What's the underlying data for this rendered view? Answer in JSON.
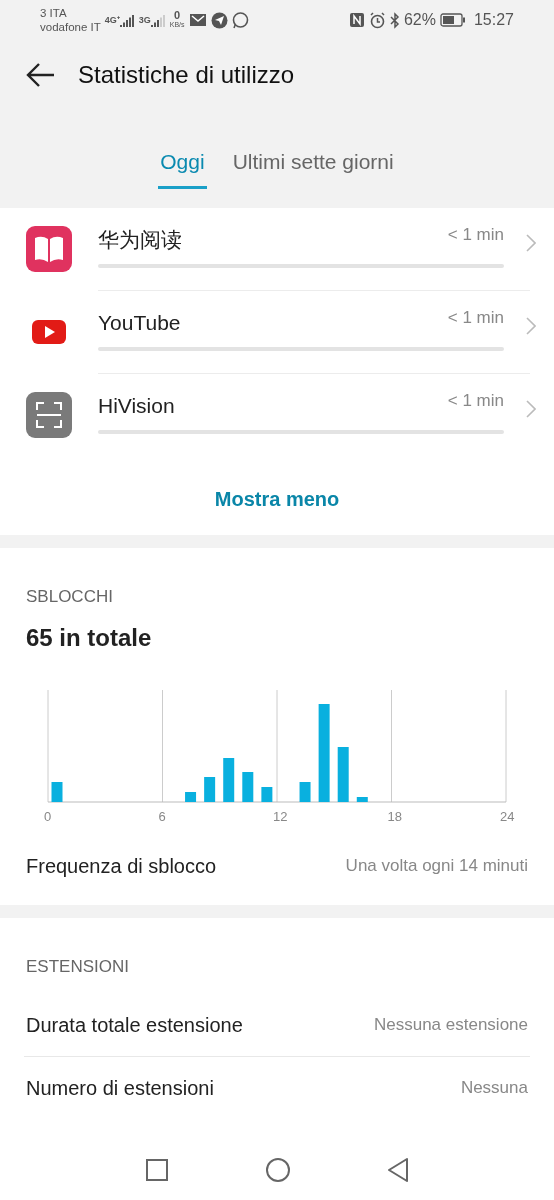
{
  "status_bar": {
    "carrier_1": "3 ITA",
    "carrier_2": "vodafone IT",
    "net_1": "4G⁺",
    "net_2": "3G",
    "speed_value": "0",
    "speed_unit": "KB/s",
    "battery_text": "62%",
    "time": "15:27"
  },
  "header": {
    "title": "Statistiche di utilizzo"
  },
  "tabs": [
    {
      "label": "Oggi",
      "selected": true
    },
    {
      "label": "Ultimi sette giorni",
      "selected": false
    }
  ],
  "apps": [
    {
      "name": "华为阅读",
      "time": "< 1 min",
      "kind": "book"
    },
    {
      "name": "YouTube",
      "time": "< 1 min",
      "kind": "video"
    },
    {
      "name": "HiVision",
      "time": "< 1 min",
      "kind": "scan"
    }
  ],
  "show_less": "Mostra meno",
  "unlocks": {
    "heading": "SBLOCCHI",
    "total": "65 in totale",
    "x_labels": [
      "0",
      "6",
      "12",
      "18",
      "24"
    ],
    "frequency_label": "Frequenza di sblocco",
    "frequency_value": "Una volta ogni 14 minuti"
  },
  "extensions": {
    "heading": "ESTENSIONI",
    "rows": [
      {
        "label": "Durata totale estensione",
        "value": "Nessuna estensione"
      },
      {
        "label": "Numero di estensioni",
        "value": "Nessuna"
      }
    ]
  }
}
